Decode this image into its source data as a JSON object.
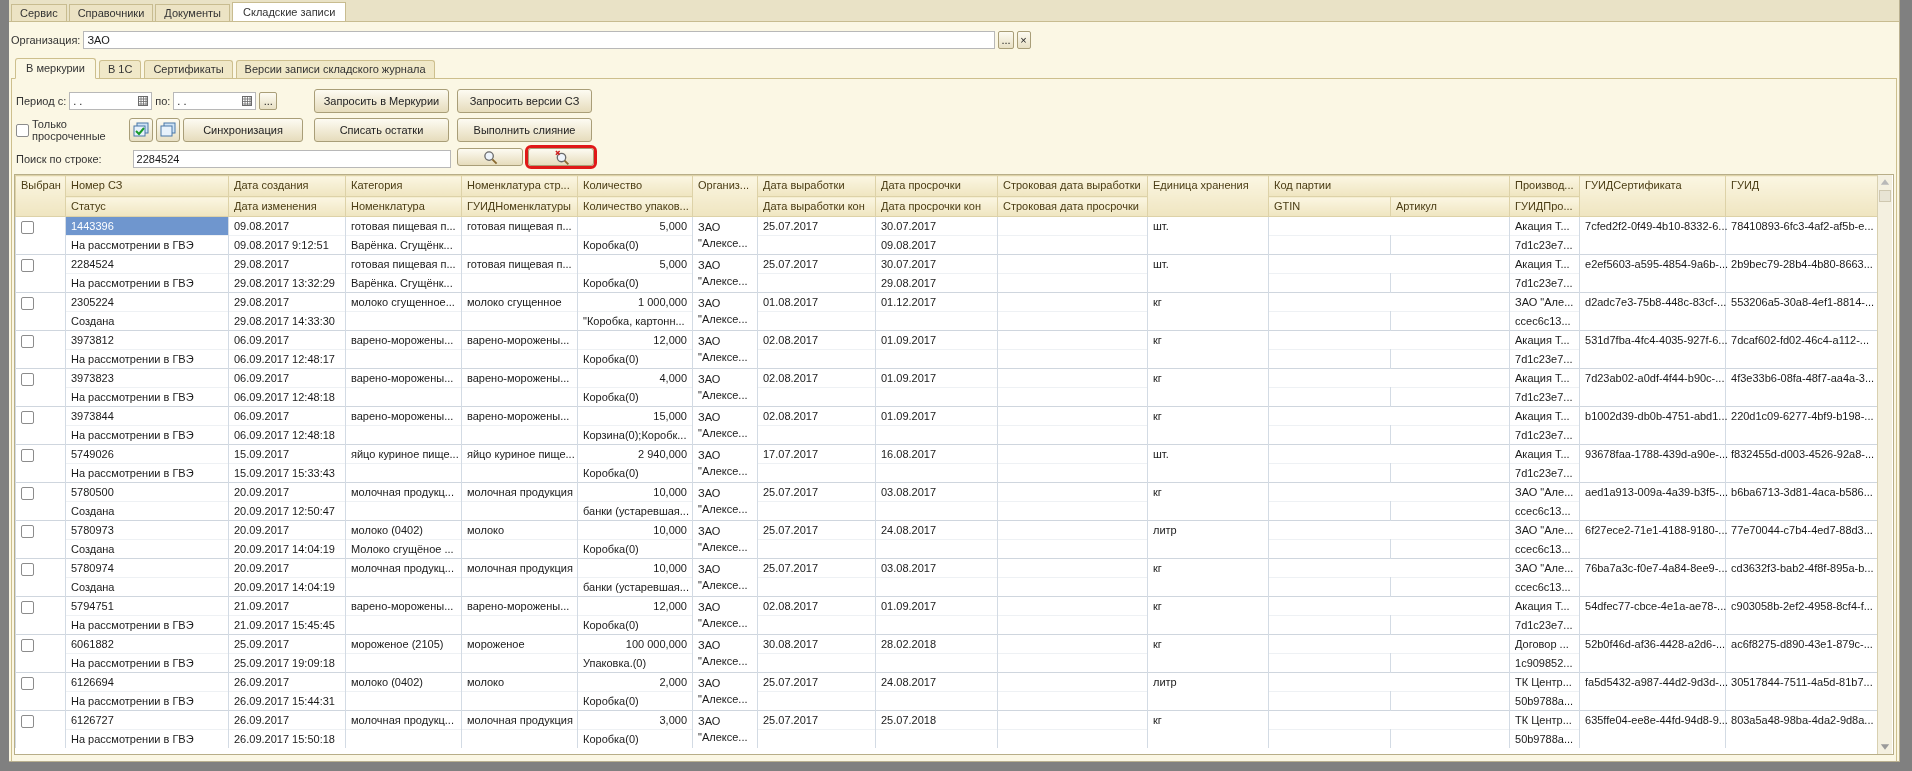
{
  "top_tabs": [
    {
      "label": "Сервис",
      "selected": false
    },
    {
      "label": "Справочники",
      "selected": false
    },
    {
      "label": "Документы",
      "selected": false
    },
    {
      "label": "Складские записи",
      "selected": true
    }
  ],
  "organization": {
    "label": "Организация:",
    "value": "ЗАО",
    "select_button": "...",
    "clear_button": "×"
  },
  "tabs": [
    {
      "label": "В меркурии",
      "selected": true
    },
    {
      "label": "В 1С",
      "selected": false
    },
    {
      "label": "Сертификаты",
      "selected": false
    },
    {
      "label": "Версии записи складского журнала",
      "selected": false
    }
  ],
  "period": {
    "from_label": "Период с:",
    "from_value": ". .",
    "to_label": "по:",
    "to_value": ". .",
    "select_button": "..."
  },
  "only_expired": {
    "label": "Только просроченные",
    "checked": false
  },
  "buttons": {
    "request_mercury": "Запросить в Меркурии",
    "request_versions": "Запросить версии СЗ",
    "sync": "Синхронизация",
    "write_off": "Списать остатки",
    "merge": "Выполнить слияние"
  },
  "search": {
    "label": "Поиск по строке:",
    "value": "2284524",
    "clear_highlighted": true
  },
  "table": {
    "columns": [
      {
        "label": "Выбран"
      },
      {
        "label": "Номер СЗ",
        "subs": [
          "Статус"
        ]
      },
      {
        "label": "Дата создания",
        "subs": [
          "Дата изменения"
        ]
      },
      {
        "label": "Категория",
        "subs": [
          "Номенклатура"
        ]
      },
      {
        "label": "Номенклатура стр...",
        "subs": [
          "ГУИДНоменклатуры"
        ]
      },
      {
        "label": "Количество",
        "subs": [
          "Количество упаков..."
        ]
      },
      {
        "label": "Организ..."
      },
      {
        "label": "Дата выработки",
        "subs": [
          "Дата выработки кон"
        ]
      },
      {
        "label": "Дата просрочки",
        "subs": [
          "Дата просрочки кон"
        ]
      },
      {
        "label": "Строковая дата выработки",
        "subs": [
          "Строковая дата просрочки"
        ]
      },
      {
        "label": "Единица хранения"
      },
      {
        "label": "Код партии",
        "subs": [
          "GTIN",
          "Артикул"
        ]
      },
      {
        "label": "Производ...",
        "subs": [
          "ГУИДПро..."
        ]
      },
      {
        "label": "ГУИДСертификата"
      },
      {
        "label": "ГУИД"
      }
    ],
    "rows": [
      {
        "checked": false,
        "selected": true,
        "number": "1443396",
        "status": "На рассмотрении в ГВЭ",
        "created": "09.08.2017",
        "modified": "09.08.2017 9:12:51",
        "category": "готовая пищевая п...",
        "nomenclature": "Варёнка. Сгущёнк...",
        "nomenclature_str": "готовая пищевая п...",
        "quantity": "5,000",
        "packaging": "Коробка(0)",
        "organization": "ЗАО \"Алексе...",
        "produced": "25.07.2017",
        "expires": "30.07.2017",
        "expires_end": "09.08.2017",
        "unit": "шт.",
        "producer": "Акация Т...",
        "producer_guid": "7d1c23e7...",
        "certificate_guid": "7cfed2f2-0f49-4b10-8332-6...",
        "guid": "78410893-6fc3-4af2-af5b-e..."
      },
      {
        "checked": false,
        "selected": false,
        "number": "2284524",
        "status": "На рассмотрении в ГВЭ",
        "created": "29.08.2017",
        "modified": "29.08.2017 13:32:29",
        "category": "готовая пищевая п...",
        "nomenclature": "Варёнка. Сгущёнк...",
        "nomenclature_str": "готовая пищевая п...",
        "quantity": "5,000",
        "packaging": "Коробка(0)",
        "organization": "ЗАО \"Алексе...",
        "produced": "25.07.2017",
        "expires": "30.07.2017",
        "expires_end": "29.08.2017",
        "unit": "шт.",
        "producer": "Акация Т...",
        "producer_guid": "7d1c23e7...",
        "certificate_guid": "e2ef5603-a595-4854-9a6b-...",
        "guid": "2b9bec79-28b4-4b80-8663..."
      },
      {
        "checked": false,
        "selected": false,
        "number": "2305224",
        "status": "Создана",
        "created": "29.08.2017",
        "modified": "29.08.2017 14:33:30",
        "category": "молоко сгущенное...",
        "nomenclature_str": "молоко сгущенное",
        "quantity": "1 000,000",
        "packaging": "\"Коробка, картонн...",
        "organization": "ЗАО \"Алексе...",
        "produced": "01.08.2017",
        "expires": "01.12.2017",
        "unit": "кг",
        "producer": "ЗАО \"Але...",
        "producer_guid": "ccec6c13...",
        "certificate_guid": "d2adc7e3-75b8-448c-83cf-...",
        "guid": "553206a5-30a8-4ef1-8814-..."
      },
      {
        "checked": false,
        "selected": false,
        "number": "3973812",
        "status": "На рассмотрении в ГВЭ",
        "created": "06.09.2017",
        "modified": "06.09.2017 12:48:17",
        "category": "варено-морожены...",
        "nomenclature_str": "варено-морожены...",
        "quantity": "12,000",
        "packaging": "Коробка(0)",
        "organization": "ЗАО \"Алексе...",
        "produced": "02.08.2017",
        "expires": "01.09.2017",
        "unit": "кг",
        "producer": "Акация Т...",
        "producer_guid": "7d1c23e7...",
        "certificate_guid": "531d7fba-4fc4-4035-927f-6...",
        "guid": "7dcaf602-fd02-46c4-a112-..."
      },
      {
        "checked": false,
        "selected": false,
        "number": "3973823",
        "status": "На рассмотрении в ГВЭ",
        "created": "06.09.2017",
        "modified": "06.09.2017 12:48:18",
        "category": "варено-морожены...",
        "nomenclature_str": "варено-морожены...",
        "quantity": "4,000",
        "packaging": "Коробка(0)",
        "organization": "ЗАО \"Алексе...",
        "produced": "02.08.2017",
        "expires": "01.09.2017",
        "unit": "кг",
        "producer": "Акация Т...",
        "producer_guid": "7d1c23e7...",
        "certificate_guid": "7d23ab02-a0df-4f44-b90c-...",
        "guid": "4f3e33b6-08fa-48f7-aa4a-3..."
      },
      {
        "checked": false,
        "selected": false,
        "number": "3973844",
        "status": "На рассмотрении в ГВЭ",
        "created": "06.09.2017",
        "modified": "06.09.2017 12:48:18",
        "category": "варено-морожены...",
        "nomenclature_str": "варено-морожены...",
        "quantity": "15,000",
        "packaging": "Корзина(0);Коробк...",
        "organization": "ЗАО \"Алексе...",
        "produced": "02.08.2017",
        "expires": "01.09.2017",
        "unit": "кг",
        "producer": "Акация Т...",
        "producer_guid": "7d1c23e7...",
        "certificate_guid": "b1002d39-db0b-4751-abd1...",
        "guid": "220d1c09-6277-4bf9-b198-..."
      },
      {
        "checked": false,
        "selected": false,
        "number": "5749026",
        "status": "На рассмотрении в ГВЭ",
        "created": "15.09.2017",
        "modified": "15.09.2017 15:33:43",
        "category": "яйцо куриное пище...",
        "nomenclature_str": "яйцо куриное пище...",
        "quantity": "2 940,000",
        "packaging": "Коробка(0)",
        "organization": "ЗАО \"Алексе...",
        "produced": "17.07.2017",
        "expires": "16.08.2017",
        "unit": "шт.",
        "producer": "Акация Т...",
        "producer_guid": "7d1c23e7...",
        "certificate_guid": "93678faa-1788-439d-a90e-...",
        "guid": "f832455d-d003-4526-92a8-..."
      },
      {
        "checked": false,
        "selected": false,
        "number": "5780500",
        "status": "Создана",
        "created": "20.09.2017",
        "modified": "20.09.2017 12:50:47",
        "category": "молочная продукц...",
        "nomenclature_str": "молочная продукция",
        "quantity": "10,000",
        "packaging": "банки (устаревшая...",
        "organization": "ЗАО \"Алексе...",
        "produced": "25.07.2017",
        "expires": "03.08.2017",
        "unit": "кг",
        "producer": "ЗАО \"Але...",
        "producer_guid": "ccec6c13...",
        "certificate_guid": "aed1a913-009a-4a39-b3f5-...",
        "guid": "b6ba6713-3d81-4aca-b586..."
      },
      {
        "checked": false,
        "selected": false,
        "number": "5780973",
        "status": "Создана",
        "created": "20.09.2017",
        "modified": "20.09.2017 14:04:19",
        "category": "молоко (0402)",
        "nomenclature": "Молоко сгущёное ...",
        "nomenclature_str": "молоко",
        "quantity": "10,000",
        "packaging": "Коробка(0)",
        "organization": "ЗАО \"Алексе...",
        "produced": "25.07.2017",
        "expires": "24.08.2017",
        "unit": "литр",
        "producer": "ЗАО \"Але...",
        "producer_guid": "ccec6c13...",
        "certificate_guid": "6f27ece2-71e1-4188-9180-...",
        "guid": "77e70044-c7b4-4ed7-88d3..."
      },
      {
        "checked": false,
        "selected": false,
        "number": "5780974",
        "status": "Создана",
        "created": "20.09.2017",
        "modified": "20.09.2017 14:04:19",
        "category": "молочная продукц...",
        "nomenclature_str": "молочная продукция",
        "quantity": "10,000",
        "packaging": "банки (устаревшая...",
        "organization": "ЗАО \"Алексе...",
        "produced": "25.07.2017",
        "expires": "03.08.2017",
        "unit": "кг",
        "producer": "ЗАО \"Але...",
        "producer_guid": "ccec6c13...",
        "certificate_guid": "76ba7a3c-f0e7-4a84-8ee9-...",
        "guid": "cd3632f3-bab2-4f8f-895a-b..."
      },
      {
        "checked": false,
        "selected": false,
        "number": "5794751",
        "status": "На рассмотрении в ГВЭ",
        "created": "21.09.2017",
        "modified": "21.09.2017 15:45:45",
        "category": "варено-морожены...",
        "nomenclature_str": "варено-морожены...",
        "quantity": "12,000",
        "packaging": "Коробка(0)",
        "organization": "ЗАО \"Алексе...",
        "produced": "02.08.2017",
        "expires": "01.09.2017",
        "unit": "кг",
        "producer": "Акация Т...",
        "producer_guid": "7d1c23e7...",
        "certificate_guid": "54dfec77-cbce-4e1a-ae78-...",
        "guid": "c903058b-2ef2-4958-8cf4-f..."
      },
      {
        "checked": false,
        "selected": false,
        "number": "6061882",
        "status": "На рассмотрении в ГВЭ",
        "created": "25.09.2017",
        "modified": "25.09.2017 19:09:18",
        "category": "мороженое (2105)",
        "nomenclature_str": "мороженое",
        "quantity": "100 000,000",
        "packaging": "Упаковка.(0)",
        "organization": "ЗАО \"Алексе...",
        "produced": "30.08.2017",
        "expires": "28.02.2018",
        "unit": "кг",
        "producer": "Договор ...",
        "producer_guid": "1c909852...",
        "certificate_guid": "52b0f46d-af36-4428-a2d6-...",
        "guid": "ac6f8275-d890-43e1-879c-..."
      },
      {
        "checked": false,
        "selected": false,
        "number": "6126694",
        "status": "На рассмотрении в ГВЭ",
        "created": "26.09.2017",
        "modified": "26.09.2017 15:44:31",
        "category": "молоко (0402)",
        "nomenclature_str": "молоко",
        "quantity": "2,000",
        "packaging": "Коробка(0)",
        "organization": "ЗАО \"Алексе...",
        "produced": "25.07.2017",
        "expires": "24.08.2017",
        "unit": "литр",
        "producer": "ТК Центр...",
        "producer_guid": "50b9788a...",
        "certificate_guid": "fa5d5432-a987-44d2-9d3d-...",
        "guid": "30517844-7511-4a5d-81b7..."
      },
      {
        "checked": false,
        "selected": false,
        "number": "6126727",
        "status": "На рассмотрении в ГВЭ",
        "created": "26.09.2017",
        "modified": "26.09.2017 15:50:18",
        "category": "молочная продукц...",
        "nomenclature_str": "молочная продукция",
        "quantity": "3,000",
        "packaging": "Коробка(0)",
        "organization": "ЗАО \"Алексе...",
        "produced": "25.07.2017",
        "expires": "25.07.2018",
        "unit": "кг",
        "producer": "ТК Центр...",
        "producer_guid": "50b9788a...",
        "certificate_guid": "635ffe04-ee8e-44fd-94d8-9...",
        "guid": "803a5a48-98ba-4da2-9d8a..."
      }
    ]
  }
}
